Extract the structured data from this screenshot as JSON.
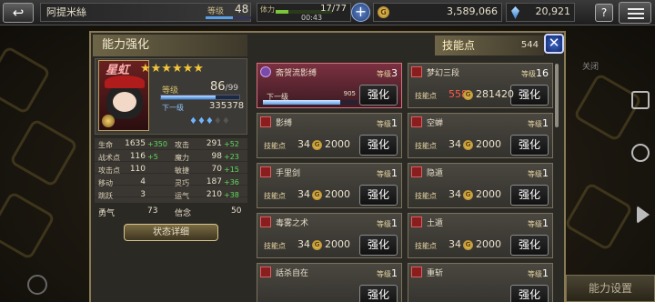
{
  "topbar": {
    "player_name": "阿提米絲",
    "level_label": "等级",
    "level": "48",
    "stamina_label": "体力",
    "stamina": "17/77",
    "stamina_timer": "00:43",
    "gil": "3,589,066",
    "gems": "20,921",
    "help": "?",
    "xp_fraction": 0.6,
    "stamina_fraction": 0.22
  },
  "panel": {
    "title": "能力强化",
    "skill_points_label": "技能点",
    "skill_points": "544",
    "close": "✕",
    "bg_right": "544"
  },
  "character": {
    "name": "星虹",
    "stars": "★★★★★★",
    "level_label": "等级",
    "level": "86",
    "level_max": "/99",
    "next_label": "下一级",
    "next_exp": "335378",
    "exp_fraction": 0.7,
    "crystals": "♦♦♦",
    "crystals_empty": "♦♦",
    "stats": [
      {
        "name": "生命",
        "value": "1635",
        "bonus": "+350"
      },
      {
        "name": "攻击",
        "value": "291",
        "bonus": "+52"
      },
      {
        "name": "战术点",
        "value": "116",
        "bonus": "+5"
      },
      {
        "name": "魔力",
        "value": "98",
        "bonus": "+23"
      },
      {
        "name": "攻击点",
        "value": "110",
        "bonus": ""
      },
      {
        "name": "敏捷",
        "value": "70",
        "bonus": "+15"
      },
      {
        "name": "移动",
        "value": "4",
        "bonus": ""
      },
      {
        "name": "灵巧",
        "value": "187",
        "bonus": "+36"
      },
      {
        "name": "跳跃",
        "value": "3",
        "bonus": ""
      },
      {
        "name": "运气",
        "value": "210",
        "bonus": "+38"
      }
    ],
    "bravery_label": "勇气",
    "bravery": "73",
    "faith_label": "信念",
    "faith": "50",
    "detail_button": "状态详细"
  },
  "abilities": {
    "level_label": "等级",
    "cost_label": "技能点",
    "upgrade_label": "强化",
    "next_label": "下一级",
    "items": [
      {
        "name": "斋贺流影缚",
        "level": "3",
        "selected": true,
        "next_progress": "905",
        "progress_fraction": 0.82
      },
      {
        "name": "梦幻三段",
        "level": "16",
        "cost": "558",
        "gil": "281420",
        "cost_red": true
      },
      {
        "name": "影缚",
        "level": "1",
        "cost": "34",
        "gil": "2000"
      },
      {
        "name": "空蝉",
        "level": "1",
        "cost": "34",
        "gil": "2000"
      },
      {
        "name": "手里剑",
        "level": "1",
        "cost": "34",
        "gil": "2000"
      },
      {
        "name": "隐遁",
        "level": "1",
        "cost": "34",
        "gil": "2000"
      },
      {
        "name": "毒雾之术",
        "level": "1",
        "cost": "34",
        "gil": "2000"
      },
      {
        "name": "土遁",
        "level": "1",
        "cost": "34",
        "gil": "2000"
      },
      {
        "name": "話杀自在",
        "level": "1",
        "cost": "",
        "gil": ""
      },
      {
        "name": "重斩",
        "level": "1",
        "cost": "",
        "gil": ""
      }
    ]
  },
  "background": {
    "toggle_label": "关闭",
    "ability_set": "能力设置"
  }
}
